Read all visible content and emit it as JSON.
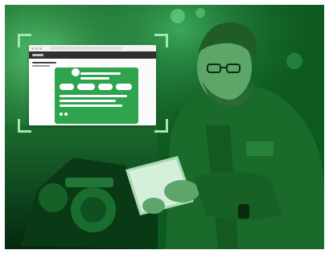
{
  "scene": {
    "subject": "",
    "accent_color": "#2ea44f",
    "tint_color": "#0b4d1a",
    "frame_color": "#9fe8b2"
  },
  "app_window": {
    "icons": [
      "window-close-icon",
      "window-minimize-icon",
      "window-maximize-icon",
      "avatar-icon"
    ]
  }
}
